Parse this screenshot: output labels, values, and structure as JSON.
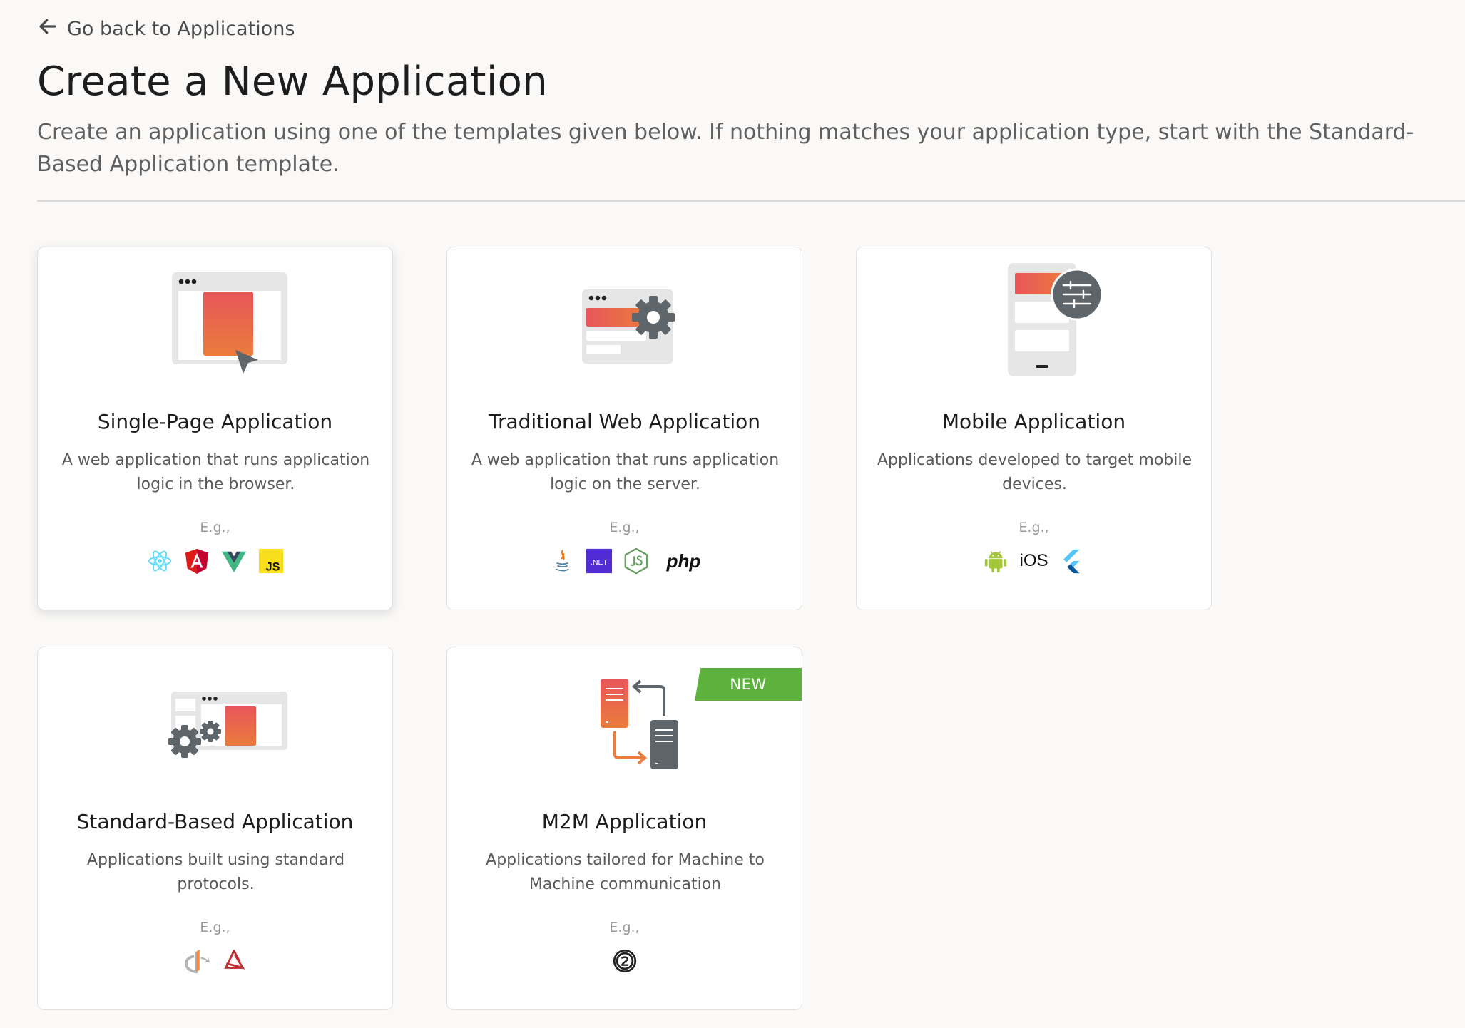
{
  "nav": {
    "back_label": "Go back to Applications"
  },
  "header": {
    "title": "Create a New Application",
    "subtitle": "Create an application using one of the templates given below. If nothing matches your application type, start with the Standard-Based Application template."
  },
  "theme": {
    "accent_gradient_start": "#e8565a",
    "accent_gradient_end": "#ea7c3d",
    "icon_gray": "#5f666b",
    "badge_green": "#5cb23d"
  },
  "templates": [
    {
      "title": "Single-Page Application",
      "description": "A web application that runs application logic in the browser.",
      "eg_label": "E.g.,",
      "technologies": [
        "react-icon",
        "angular-icon",
        "vue-icon",
        "javascript-icon"
      ],
      "js_text": "JS"
    },
    {
      "title": "Traditional Web Application",
      "description": "A web application that runs application logic on the server.",
      "eg_label": "E.g.,",
      "technologies": [
        "java-icon",
        "dotnet-icon",
        "nodejs-icon",
        "php-text"
      ],
      "dotnet_text": ".NET",
      "php_text": "php"
    },
    {
      "title": "Mobile Application",
      "description": "Applications developed to target mobile devices.",
      "eg_label": "E.g.,",
      "technologies": [
        "android-icon",
        "ios-text",
        "flutter-icon"
      ],
      "ios_text": "iOS"
    },
    {
      "title": "Standard-Based Application",
      "description": "Applications built using standard protocols.",
      "eg_label": "E.g.,",
      "technologies": [
        "openid-icon",
        "saml-icon"
      ]
    },
    {
      "title": "M2M Application",
      "description": "Applications tailored for Machine to Machine communication",
      "eg_label": "E.g.,",
      "technologies": [
        "oauth2-icon"
      ],
      "badge": "NEW"
    }
  ]
}
